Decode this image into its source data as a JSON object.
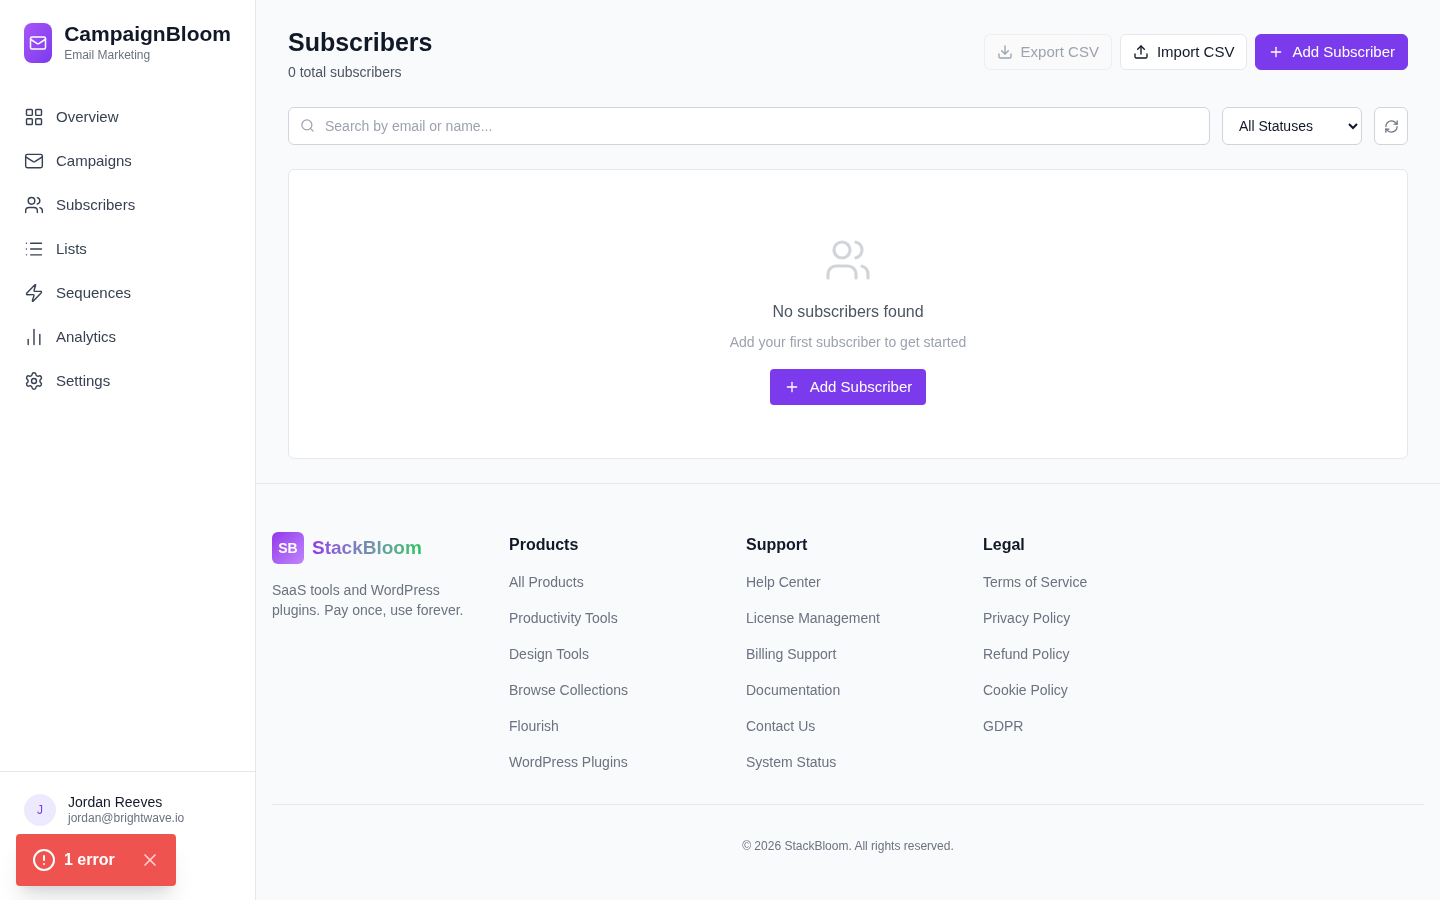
{
  "brand": {
    "name": "CampaignBloom",
    "tagline": "Email Marketing"
  },
  "nav": [
    {
      "label": "Overview",
      "selected": false
    },
    {
      "label": "Campaigns",
      "selected": false
    },
    {
      "label": "Subscribers",
      "selected": false
    },
    {
      "label": "Lists",
      "selected": false
    },
    {
      "label": "Sequences",
      "selected": false
    },
    {
      "label": "Analytics",
      "selected": false
    },
    {
      "label": "Settings",
      "selected": false
    }
  ],
  "user": {
    "initial": "J",
    "name": "Jordan Reeves",
    "email": "jordan@brightwave.io"
  },
  "toast": {
    "text": "1 error"
  },
  "header": {
    "title": "Subscribers",
    "subtitle": "0 total subscribers"
  },
  "actions": [
    {
      "label": "Export CSV",
      "kind": "export",
      "disabled": true
    },
    {
      "label": "Import CSV",
      "kind": "import",
      "disabled": false
    },
    {
      "label": "Add Subscriber",
      "kind": "primary",
      "disabled": false
    }
  ],
  "search": {
    "placeholder": "Search by email or name..."
  },
  "status_filter": {
    "value": "All Statuses"
  },
  "empty_state": {
    "title": "No subscribers found",
    "text": "Add your first subscriber to get started",
    "button": "Add Subscriber"
  },
  "footer": {
    "logo_mark": "SB",
    "logo_name": "StackBloom",
    "blurb": "SaaS tools and WordPress plugins. Pay once, use forever.",
    "columns": [
      {
        "heading": "Products",
        "links": [
          "All Products",
          "Productivity Tools",
          "Design Tools",
          "Browse Collections",
          "Flourish",
          "WordPress Plugins"
        ]
      },
      {
        "heading": "Support",
        "links": [
          "Help Center",
          "License Management",
          "Billing Support",
          "Documentation",
          "Contact Us",
          "System Status"
        ]
      },
      {
        "heading": "Legal",
        "links": [
          "Terms of Service",
          "Privacy Policy",
          "Refund Policy",
          "Cookie Policy",
          "GDPR"
        ]
      }
    ],
    "copyright": "© 2026 StackBloom. All rights reserved."
  }
}
